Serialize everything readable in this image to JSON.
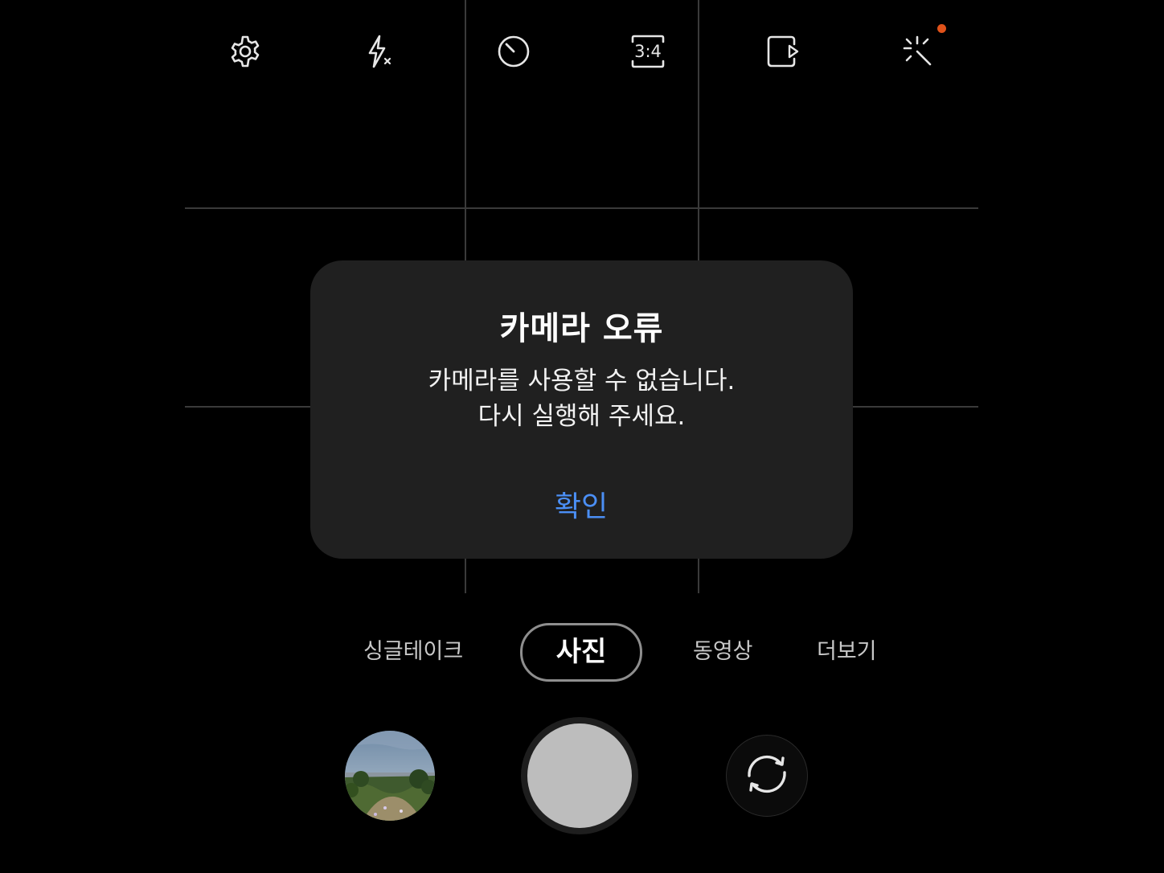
{
  "toolbar": {
    "icons": [
      "settings-icon",
      "flash-off-icon",
      "timer-icon",
      "aspect-ratio-icon",
      "motion-photo-icon",
      "filter-effects-icon"
    ],
    "aspect_ratio_label": "3:4",
    "notification_color": "#e0521a"
  },
  "dialog": {
    "title": "카메라 오류",
    "message_line1": "카메라를 사용할 수 없습니다.",
    "message_line2": "다시 실행해 주세요.",
    "ok_label": "확인",
    "ok_color": "#4b8ff5"
  },
  "modes": {
    "items": [
      "싱글테이크",
      "사진",
      "동영상",
      "더보기"
    ],
    "selected": "사진"
  },
  "controls": {
    "gallery_thumbnail": "gallery-thumbnail",
    "shutter": "shutter-button",
    "switch_camera": "switch-camera-icon"
  }
}
